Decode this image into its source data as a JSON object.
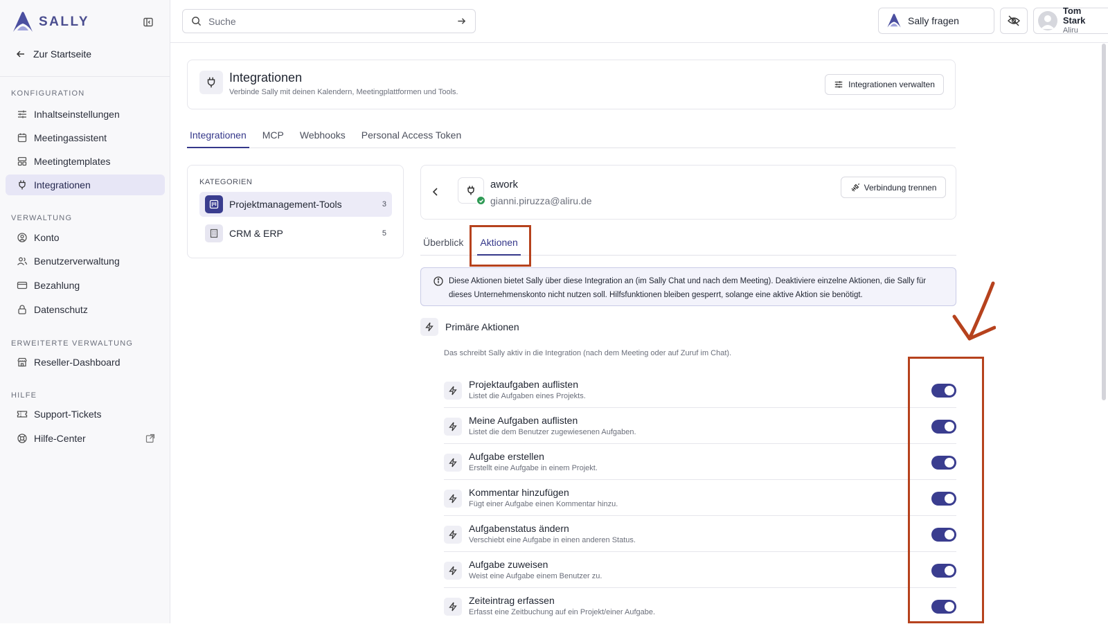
{
  "app": {
    "brand": "SALLY",
    "accent": "#3a3d8f",
    "annotation_color": "#b6421d"
  },
  "sidebar": {
    "home_link": "Zur Startseite",
    "sections": [
      {
        "label": "KONFIGURATION",
        "items": [
          {
            "label": "Inhaltseinstellungen",
            "icon": "sliders-icon"
          },
          {
            "label": "Meetingassistent",
            "icon": "calendar-icon"
          },
          {
            "label": "Meetingtemplates",
            "icon": "template-icon"
          },
          {
            "label": "Integrationen",
            "icon": "plug-icon",
            "active": true
          }
        ]
      },
      {
        "label": "VERWALTUNG",
        "items": [
          {
            "label": "Konto",
            "icon": "user-circle-icon"
          },
          {
            "label": "Benutzerverwaltung",
            "icon": "users-icon"
          },
          {
            "label": "Bezahlung",
            "icon": "credit-card-icon"
          },
          {
            "label": "Datenschutz",
            "icon": "lock-icon"
          }
        ]
      },
      {
        "label": "ERWEITERTE VERWALTUNG",
        "items": [
          {
            "label": "Reseller-Dashboard",
            "icon": "store-icon"
          }
        ]
      },
      {
        "label": "HILFE",
        "items": [
          {
            "label": "Support-Tickets",
            "icon": "ticket-icon"
          },
          {
            "label": "Hilfe-Center",
            "icon": "lifebuoy-icon",
            "external": true
          }
        ]
      }
    ]
  },
  "topbar": {
    "search_placeholder": "Suche",
    "ask_label": "Sally fragen",
    "user_name": "Tom Stark",
    "user_org": "Aliru"
  },
  "page": {
    "title": "Integrationen",
    "subtitle": "Verbinde Sally mit deinen Kalendern, Meetingplattformen und Tools.",
    "manage_label": "Integrationen verwalten",
    "tabs": [
      {
        "label": "Integrationen",
        "active": true
      },
      {
        "label": "MCP"
      },
      {
        "label": "Webhooks"
      },
      {
        "label": "Personal Access Token"
      }
    ]
  },
  "categories": {
    "label": "KATEGORIEN",
    "items": [
      {
        "label": "Projektmanagement-Tools",
        "count": "3",
        "active": true
      },
      {
        "label": "CRM & ERP",
        "count": "5"
      }
    ]
  },
  "integration": {
    "name": "awork",
    "email": "gianni.piruzza@aliru.de",
    "disconnect_label": "Verbindung trennen",
    "tabs": [
      {
        "label": "Überblick"
      },
      {
        "label": "Aktionen",
        "active": true
      }
    ],
    "info": "Diese Aktionen bietet Sally über diese Integration an (im Sally Chat und nach dem Meeting). Deaktiviere einzelne Aktionen, die Sally für dieses Unternehmenskonto nicht nutzen soll. Hilfsfunktionen bleiben gesperrt, solange eine aktive Aktion sie benötigt.",
    "section_title": "Primäre Aktionen",
    "section_desc": "Das schreibt Sally aktiv in die Integration (nach dem Meeting oder auf Zuruf im Chat).",
    "actions": [
      {
        "title": "Projektaufgaben auflisten",
        "desc": "Listet die Aufgaben eines Projekts.",
        "enabled": true
      },
      {
        "title": "Meine Aufgaben auflisten",
        "desc": "Listet die dem Benutzer zugewiesenen Aufgaben.",
        "enabled": true
      },
      {
        "title": "Aufgabe erstellen",
        "desc": "Erstellt eine Aufgabe in einem Projekt.",
        "enabled": true
      },
      {
        "title": "Kommentar hinzufügen",
        "desc": "Fügt einer Aufgabe einen Kommentar hinzu.",
        "enabled": true
      },
      {
        "title": "Aufgabenstatus ändern",
        "desc": "Verschiebt eine Aufgabe in einen anderen Status.",
        "enabled": true
      },
      {
        "title": "Aufgabe zuweisen",
        "desc": "Weist eine Aufgabe einem Benutzer zu.",
        "enabled": true
      },
      {
        "title": "Zeiteintrag erfassen",
        "desc": "Erfasst eine Zeitbuchung auf ein Projekt/einer Aufgabe.",
        "enabled": true
      }
    ]
  }
}
